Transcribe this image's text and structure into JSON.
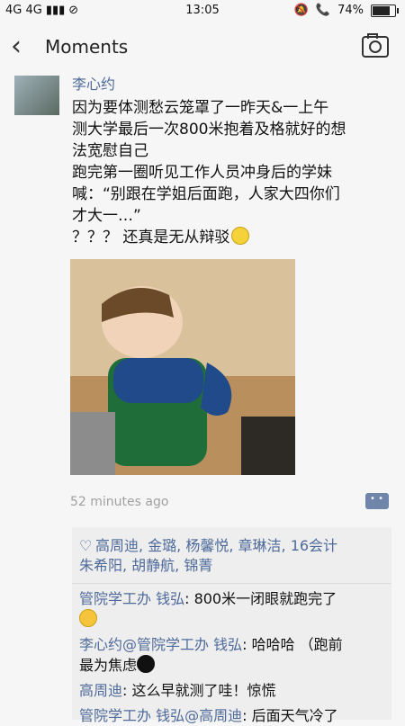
{
  "status_bar": {
    "network": "4G 4G",
    "time": "13:05",
    "battery": "74%"
  },
  "nav": {
    "back_icon": "‹",
    "title": "Moments",
    "camera_icon": "camera-icon"
  },
  "post": {
    "author": "李心约",
    "text_lines": [
      "因为要体测愁云笼罩了一昨天&一上午",
      "测大学最后一次800米抱着及格就好的想",
      "法宽慰自己",
      "跑完第一圈听见工作人员冲身后的学妹",
      "喊：“别跟在学姐后面跑，人家大四你们",
      "才大一…”",
      "？？？ 还真是无从辩驳"
    ],
    "time_ago": "52 minutes ago"
  },
  "likes": {
    "text_line1": "高周迪, 金璐, 杨馨悦, 章琳洁, 16会计",
    "text_line2": "朱希阳, 胡静航, 锦菁"
  },
  "comments": [
    {
      "author": "管院学工办 钱弘",
      "text": ": 800米一闭眼就跑完了",
      "emoji": "laugh"
    },
    {
      "author": "李心约@管院学工办 钱弘",
      "text": ": 哈哈哈 （跑前",
      "text2": "最为焦虑",
      "emoji": "penguin"
    },
    {
      "author": "高周迪",
      "text": ": 这么早就测了哇！惊慌"
    },
    {
      "author": "管院学工办 钱弘@高周迪",
      "text": ": 后面天气冷了"
    }
  ]
}
